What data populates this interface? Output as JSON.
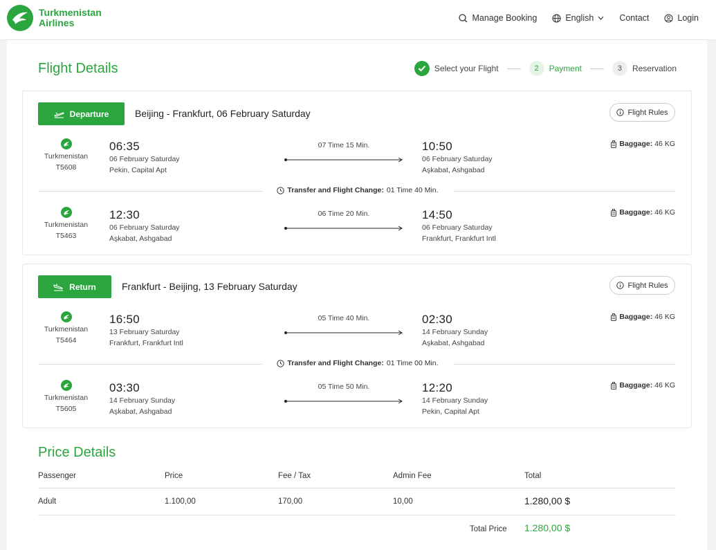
{
  "header": {
    "brand_line1": "Turkmenistan",
    "brand_line2": "Airlines",
    "nav": {
      "manage_booking": "Manage Booking",
      "language": "English",
      "contact": "Contact",
      "login": "Login"
    }
  },
  "page_title": "Flight Details",
  "steps": [
    {
      "number": "",
      "label": "Select your Flight",
      "state": "done"
    },
    {
      "number": "2",
      "label": "Payment",
      "state": "active"
    },
    {
      "number": "3",
      "label": "Reservation",
      "state": "pending"
    }
  ],
  "departure": {
    "button_label": "Departure",
    "route": "Beijing - Frankfurt, 06 February Saturday",
    "rules_label": "Flight Rules",
    "legs": [
      {
        "airline": "Turkmenistan",
        "flight_no": "T5608",
        "dep_time": "06:35",
        "dep_date": "06 February Saturday",
        "dep_airport": "Pekin, Capital Apt",
        "duration": "07 Time 15 Min.",
        "arr_time": "10:50",
        "arr_date": "06 February Saturday",
        "arr_airport": "Aşkabat, Ashgabad",
        "baggage_label": "Baggage:",
        "baggage_value": "46 KG"
      },
      {
        "airline": "Turkmenistan",
        "flight_no": "T5463",
        "dep_time": "12:30",
        "dep_date": "06 February Saturday",
        "dep_airport": "Aşkabat, Ashgabad",
        "duration": "06 Time 20 Min.",
        "arr_time": "14:50",
        "arr_date": "06 February Saturday",
        "arr_airport": "Frankfurt, Frankfurt Intl",
        "baggage_label": "Baggage:",
        "baggage_value": "46 KG"
      }
    ],
    "transfer_label": "Transfer and Flight Change:",
    "transfer_value": "01 Time 40 Min."
  },
  "return": {
    "button_label": "Return",
    "route": "Frankfurt - Beijing, 13 February Saturday",
    "rules_label": "Flight Rules",
    "legs": [
      {
        "airline": "Turkmenistan",
        "flight_no": "T5464",
        "dep_time": "16:50",
        "dep_date": "13 February Saturday",
        "dep_airport": "Frankfurt, Frankfurt Intl",
        "duration": "05 Time 40 Min.",
        "arr_time": "02:30",
        "arr_date": "14 February Sunday",
        "arr_airport": "Aşkabat, Ashgabad",
        "baggage_label": "Baggage:",
        "baggage_value": "46 KG"
      },
      {
        "airline": "Turkmenistan",
        "flight_no": "T5605",
        "dep_time": "03:30",
        "dep_date": "14 February Sunday",
        "dep_airport": "Aşkabat, Ashgabad",
        "duration": "05 Time 50 Min.",
        "arr_time": "12:20",
        "arr_date": "14 February Sunday",
        "arr_airport": "Pekin, Capital Apt",
        "baggage_label": "Baggage:",
        "baggage_value": "46 KG"
      }
    ],
    "transfer_label": "Transfer and Flight Change:",
    "transfer_value": "01 Time 00 Min."
  },
  "price": {
    "title": "Price Details",
    "headers": [
      "Passenger",
      "Price",
      "Fee / Tax",
      "Admin Fee",
      "Total"
    ],
    "rows": [
      [
        "Adult",
        "1.100,00",
        "170,00",
        "10,00",
        "1.280,00 $"
      ]
    ],
    "total_label": "Total Price",
    "total_value": "1.280,00 $"
  },
  "colors": {
    "brand_green": "#2ba63f",
    "active_step_bg": "#e6f4e8"
  }
}
